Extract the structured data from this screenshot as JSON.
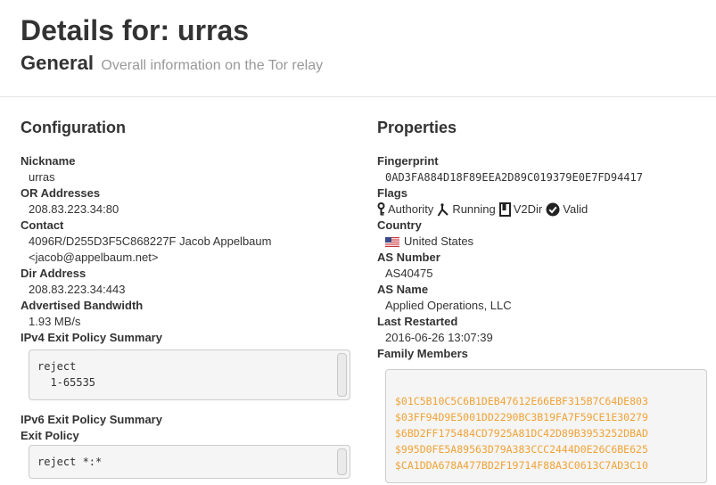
{
  "header": {
    "title": "Details for: urras",
    "subtitle": "General",
    "subtitle_desc": "Overall information on the Tor relay"
  },
  "configuration": {
    "heading": "Configuration",
    "nickname_label": "Nickname",
    "nickname": "urras",
    "or_addresses_label": "OR Addresses",
    "or_addresses": "208.83.223.34:80",
    "contact_label": "Contact",
    "contact_line1": "4096R/D255D3F5C868227F Jacob Appelbaum",
    "contact_line2": "<jacob@appelbaum.net>",
    "dir_address_label": "Dir Address",
    "dir_address": "208.83.223.34:443",
    "bandwidth_label": "Advertised Bandwidth",
    "bandwidth": "1.93 MB/s",
    "ipv4_label": "IPv4 Exit Policy Summary",
    "ipv4_lines": [
      "reject",
      "  1-65535"
    ],
    "ipv6_label": "IPv6 Exit Policy Summary",
    "exit_policy_label": "Exit Policy",
    "exit_policy_lines": [
      "reject *:*"
    ]
  },
  "properties": {
    "heading": "Properties",
    "fingerprint_label": "Fingerprint",
    "fingerprint": "0AD3FA884D18F89EEA2D89C019379E0E7FD94417",
    "flags_label": "Flags",
    "flags": [
      {
        "label": "Authority",
        "icon": "key-icon"
      },
      {
        "label": "Running",
        "icon": "fork-icon"
      },
      {
        "label": "V2Dir",
        "icon": "book-icon"
      },
      {
        "label": "Valid",
        "icon": "check-circle-icon"
      }
    ],
    "country_label": "Country",
    "country": "United States",
    "country_icon": "us-flag-icon",
    "as_number_label": "AS Number",
    "as_number": "AS40475",
    "as_name_label": "AS Name",
    "as_name": "Applied Operations, LLC",
    "last_restarted_label": "Last Restarted",
    "last_restarted": "2016-06-26 13:07:39",
    "family_label": "Family Members",
    "family": [
      "$01C5B10C5C6B1DEB47612E66EBF315B7C64DE803",
      "$03FF94D9E5001DD2290BC3B19FA7F59CE1E30279",
      "$6BD2FF175484CD7925A81DC42D89B3953252DBAD",
      "$995D0FE5A89563D79A383CCC2444D0E26C6BE625",
      "$CA1DDA678A477BD2F19714F88A3C0613C7AD3C10"
    ]
  },
  "colors": {
    "family_link": "#f0a236",
    "muted_text": "#999999",
    "box_bg": "#f5f5f5"
  }
}
